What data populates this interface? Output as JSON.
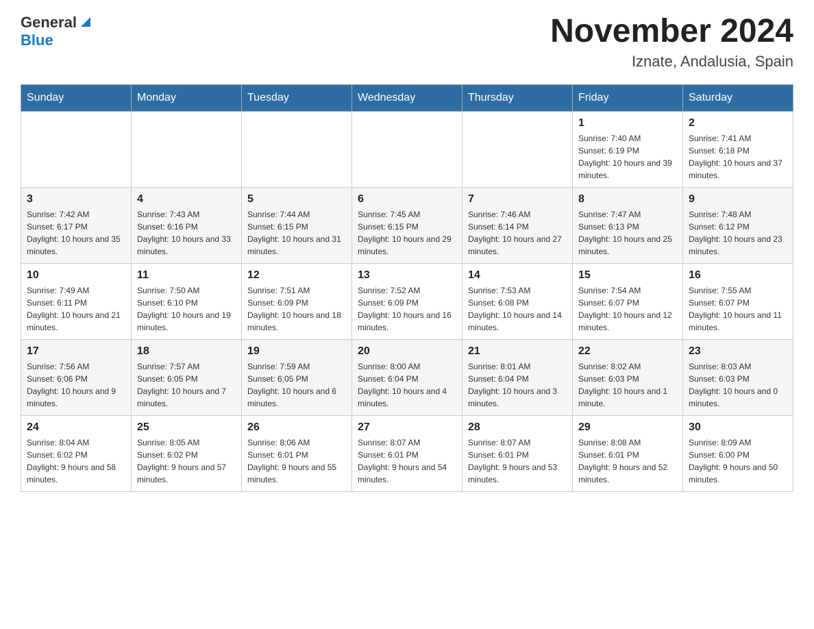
{
  "header": {
    "logo_general": "General",
    "logo_blue": "Blue",
    "month_title": "November 2024",
    "location": "Iznate, Andalusia, Spain"
  },
  "weekdays": [
    "Sunday",
    "Monday",
    "Tuesday",
    "Wednesday",
    "Thursday",
    "Friday",
    "Saturday"
  ],
  "weeks": [
    [
      {
        "day": "",
        "info": ""
      },
      {
        "day": "",
        "info": ""
      },
      {
        "day": "",
        "info": ""
      },
      {
        "day": "",
        "info": ""
      },
      {
        "day": "",
        "info": ""
      },
      {
        "day": "1",
        "info": "Sunrise: 7:40 AM\nSunset: 6:19 PM\nDaylight: 10 hours and 39 minutes."
      },
      {
        "day": "2",
        "info": "Sunrise: 7:41 AM\nSunset: 6:18 PM\nDaylight: 10 hours and 37 minutes."
      }
    ],
    [
      {
        "day": "3",
        "info": "Sunrise: 7:42 AM\nSunset: 6:17 PM\nDaylight: 10 hours and 35 minutes."
      },
      {
        "day": "4",
        "info": "Sunrise: 7:43 AM\nSunset: 6:16 PM\nDaylight: 10 hours and 33 minutes."
      },
      {
        "day": "5",
        "info": "Sunrise: 7:44 AM\nSunset: 6:15 PM\nDaylight: 10 hours and 31 minutes."
      },
      {
        "day": "6",
        "info": "Sunrise: 7:45 AM\nSunset: 6:15 PM\nDaylight: 10 hours and 29 minutes."
      },
      {
        "day": "7",
        "info": "Sunrise: 7:46 AM\nSunset: 6:14 PM\nDaylight: 10 hours and 27 minutes."
      },
      {
        "day": "8",
        "info": "Sunrise: 7:47 AM\nSunset: 6:13 PM\nDaylight: 10 hours and 25 minutes."
      },
      {
        "day": "9",
        "info": "Sunrise: 7:48 AM\nSunset: 6:12 PM\nDaylight: 10 hours and 23 minutes."
      }
    ],
    [
      {
        "day": "10",
        "info": "Sunrise: 7:49 AM\nSunset: 6:11 PM\nDaylight: 10 hours and 21 minutes."
      },
      {
        "day": "11",
        "info": "Sunrise: 7:50 AM\nSunset: 6:10 PM\nDaylight: 10 hours and 19 minutes."
      },
      {
        "day": "12",
        "info": "Sunrise: 7:51 AM\nSunset: 6:09 PM\nDaylight: 10 hours and 18 minutes."
      },
      {
        "day": "13",
        "info": "Sunrise: 7:52 AM\nSunset: 6:09 PM\nDaylight: 10 hours and 16 minutes."
      },
      {
        "day": "14",
        "info": "Sunrise: 7:53 AM\nSunset: 6:08 PM\nDaylight: 10 hours and 14 minutes."
      },
      {
        "day": "15",
        "info": "Sunrise: 7:54 AM\nSunset: 6:07 PM\nDaylight: 10 hours and 12 minutes."
      },
      {
        "day": "16",
        "info": "Sunrise: 7:55 AM\nSunset: 6:07 PM\nDaylight: 10 hours and 11 minutes."
      }
    ],
    [
      {
        "day": "17",
        "info": "Sunrise: 7:56 AM\nSunset: 6:06 PM\nDaylight: 10 hours and 9 minutes."
      },
      {
        "day": "18",
        "info": "Sunrise: 7:57 AM\nSunset: 6:05 PM\nDaylight: 10 hours and 7 minutes."
      },
      {
        "day": "19",
        "info": "Sunrise: 7:59 AM\nSunset: 6:05 PM\nDaylight: 10 hours and 6 minutes."
      },
      {
        "day": "20",
        "info": "Sunrise: 8:00 AM\nSunset: 6:04 PM\nDaylight: 10 hours and 4 minutes."
      },
      {
        "day": "21",
        "info": "Sunrise: 8:01 AM\nSunset: 6:04 PM\nDaylight: 10 hours and 3 minutes."
      },
      {
        "day": "22",
        "info": "Sunrise: 8:02 AM\nSunset: 6:03 PM\nDaylight: 10 hours and 1 minute."
      },
      {
        "day": "23",
        "info": "Sunrise: 8:03 AM\nSunset: 6:03 PM\nDaylight: 10 hours and 0 minutes."
      }
    ],
    [
      {
        "day": "24",
        "info": "Sunrise: 8:04 AM\nSunset: 6:02 PM\nDaylight: 9 hours and 58 minutes."
      },
      {
        "day": "25",
        "info": "Sunrise: 8:05 AM\nSunset: 6:02 PM\nDaylight: 9 hours and 57 minutes."
      },
      {
        "day": "26",
        "info": "Sunrise: 8:06 AM\nSunset: 6:01 PM\nDaylight: 9 hours and 55 minutes."
      },
      {
        "day": "27",
        "info": "Sunrise: 8:07 AM\nSunset: 6:01 PM\nDaylight: 9 hours and 54 minutes."
      },
      {
        "day": "28",
        "info": "Sunrise: 8:07 AM\nSunset: 6:01 PM\nDaylight: 9 hours and 53 minutes."
      },
      {
        "day": "29",
        "info": "Sunrise: 8:08 AM\nSunset: 6:01 PM\nDaylight: 9 hours and 52 minutes."
      },
      {
        "day": "30",
        "info": "Sunrise: 8:09 AM\nSunset: 6:00 PM\nDaylight: 9 hours and 50 minutes."
      }
    ]
  ]
}
